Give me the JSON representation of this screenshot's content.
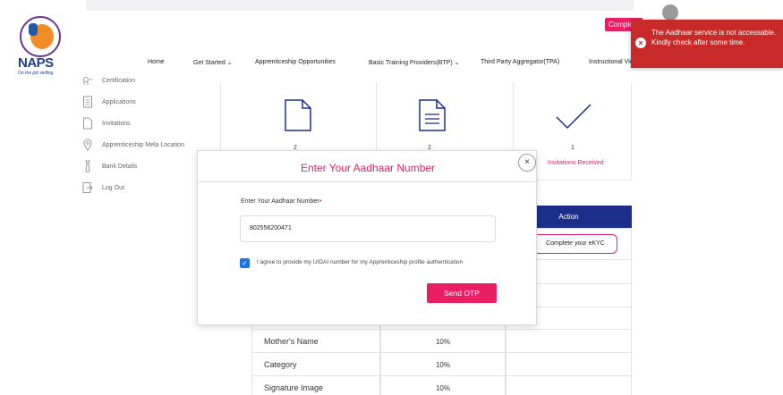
{
  "header": {
    "logo_text": "NAPS",
    "logo_tagline": "On the job skilling",
    "complete_button": "Complete",
    "nav": [
      {
        "label": "Home",
        "has_dropdown": false
      },
      {
        "label": "Get Started",
        "has_dropdown": true
      },
      {
        "label": "Apprenticeship Opportunities",
        "has_dropdown": false
      },
      {
        "label": "Basic Training Providers(BTP)",
        "has_dropdown": true
      },
      {
        "label": "Third Party Aggregator(TPA)",
        "has_dropdown": false
      },
      {
        "label": "Instructional Vid",
        "has_dropdown": false
      }
    ]
  },
  "sidebar": {
    "items": [
      {
        "label": "Certification",
        "icon": "certificate-icon"
      },
      {
        "label": "Applications",
        "icon": "document-icon"
      },
      {
        "label": "Invitations",
        "icon": "file-icon"
      },
      {
        "label": "Apprenticeship Mela Location",
        "icon": "location-pin-icon"
      },
      {
        "label": "Bank Details",
        "icon": "bank-icon"
      },
      {
        "label": "Log Out",
        "icon": "logout-icon"
      }
    ]
  },
  "cards": [
    {
      "count": "2",
      "label": "",
      "icon": "file-outline-icon"
    },
    {
      "count": "2",
      "label": "",
      "icon": "document-lines-icon"
    },
    {
      "count": "1",
      "label": "Invitations Received",
      "icon": "checkmark-icon"
    }
  ],
  "table": {
    "action_header": "Action",
    "ekyc_button": "Complete your eKYC",
    "rows": [
      {
        "label": "Mother's Name",
        "value": "10%"
      },
      {
        "label": "Category",
        "value": "10%"
      },
      {
        "label": "Signature Image",
        "value": "10%"
      }
    ]
  },
  "modal": {
    "title": "Enter Your Aadhaar Number",
    "close_symbol": "×",
    "field_label": "Enter Your Aadhaar Number",
    "required_mark": "*",
    "field_value": "802556200471",
    "checkbox_checked": true,
    "checkbox_mark": "✓",
    "agree_text": "I agree to provide my UIDAI number for my Apprenticeship profile authentication",
    "send_button": "Send OTP"
  },
  "toast": {
    "icon_symbol": "×",
    "message": "The Aadhaar service is not accessable. Kindly check after some time."
  },
  "colors": {
    "accent_pink": "#ea1e63",
    "navy": "#1b2f8a",
    "toast_red": "#c82a2a",
    "checkbox_blue": "#1e73e8"
  }
}
